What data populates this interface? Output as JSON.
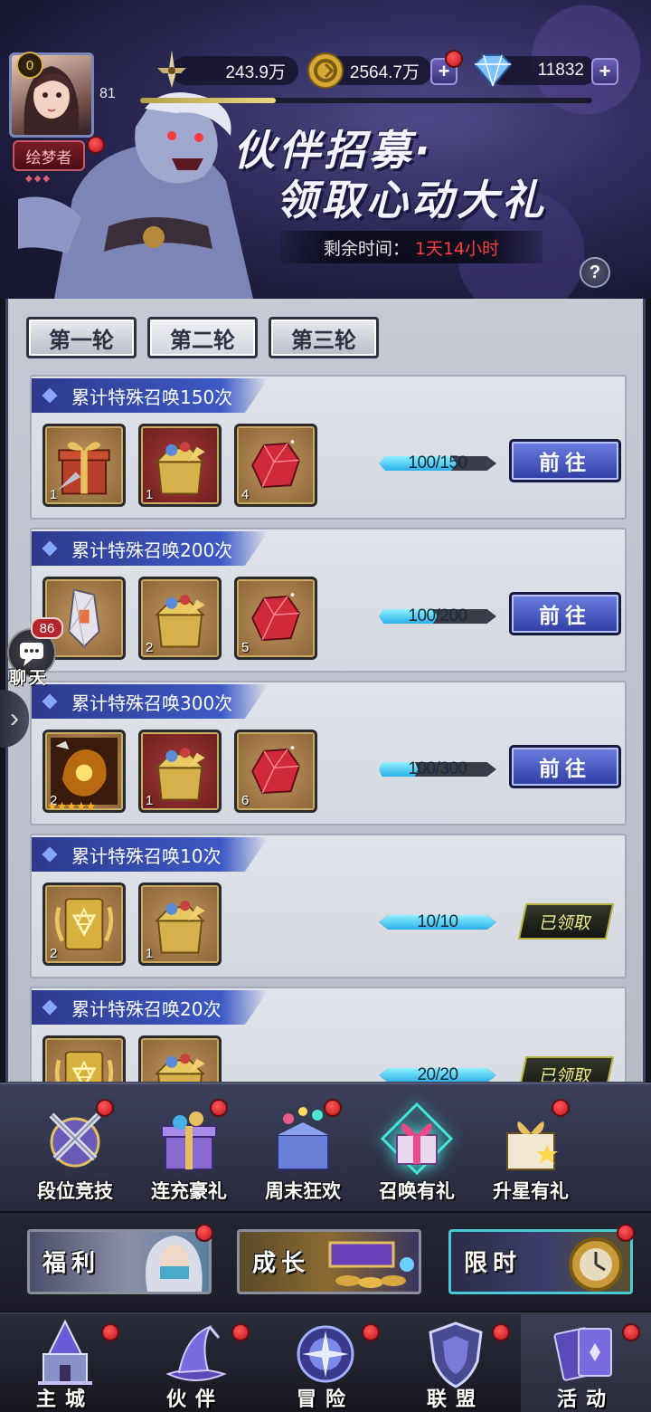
{
  "player": {
    "vip_level": "0",
    "level": "81",
    "title": "绘梦者",
    "exp_progress": 0.3
  },
  "resources": {
    "power": "243.9万",
    "gold": "2564.7万",
    "diamonds": "11832",
    "plus_symbol": "+"
  },
  "banner": {
    "title_line1": "伙伴招募·",
    "title_line2": "领取心动大礼",
    "countdown_label": "剩余时间：",
    "countdown_value": "1天14小时",
    "help_symbol": "?"
  },
  "round_tabs": [
    "第一轮",
    "第二轮",
    "第三轮"
  ],
  "tasks": [
    {
      "title": "累计特殊召唤150次",
      "progress_text": "100/150",
      "progress": 0.667,
      "action": "前往",
      "rewards": [
        {
          "icon": "gift-box-icon",
          "count": "1",
          "frame": "brown"
        },
        {
          "icon": "golden-chest-icon",
          "count": "1",
          "frame": "red"
        },
        {
          "icon": "red-crystal-icon",
          "count": "4",
          "frame": "brown"
        }
      ]
    },
    {
      "title": "累计特殊召唤200次",
      "progress_text": "100/200",
      "progress": 0.5,
      "action": "前往",
      "rewards": [
        {
          "icon": "crystal-shard-icon",
          "count": "",
          "frame": "brown"
        },
        {
          "icon": "golden-chest-icon",
          "count": "2",
          "frame": "brown"
        },
        {
          "icon": "red-crystal-icon",
          "count": "5",
          "frame": "brown"
        }
      ]
    },
    {
      "title": "累计特殊召唤300次",
      "progress_text": "100/300",
      "progress": 0.333,
      "action": "前往",
      "rewards": [
        {
          "icon": "hero-fragment-icon",
          "count": "2",
          "frame": "brown",
          "stars": "★★★★★"
        },
        {
          "icon": "golden-chest-icon",
          "count": "1",
          "frame": "red"
        },
        {
          "icon": "red-crystal-icon",
          "count": "6",
          "frame": "brown"
        }
      ]
    },
    {
      "title": "累计特殊召唤10次",
      "progress_text": "10/10",
      "progress": 1,
      "action": "已领取",
      "rewards": [
        {
          "icon": "golden-scroll-icon",
          "count": "2",
          "frame": "brown"
        },
        {
          "icon": "golden-chest-icon",
          "count": "1",
          "frame": "brown"
        }
      ]
    },
    {
      "title": "累计特殊召唤20次",
      "progress_text": "20/20",
      "progress": 1,
      "action": "已领取",
      "rewards": [
        {
          "icon": "golden-scroll-icon",
          "count": "",
          "frame": "brown"
        },
        {
          "icon": "golden-chest-icon",
          "count": "",
          "frame": "brown"
        }
      ]
    }
  ],
  "chat": {
    "count": "86",
    "label": "聊天",
    "arrow": "›"
  },
  "activities": [
    {
      "label": "段位竞技",
      "icon": "crossed-swords-icon",
      "badge": true
    },
    {
      "label": "连充豪礼",
      "icon": "treasure-gift-icon",
      "badge": true
    },
    {
      "label": "周末狂欢",
      "icon": "party-gift-icon",
      "badge": true
    },
    {
      "label": "召唤有礼",
      "icon": "pink-gift-icon",
      "badge": false,
      "active": true
    },
    {
      "label": "升星有礼",
      "icon": "star-gift-icon",
      "badge": true
    }
  ],
  "categories": [
    {
      "label": "福利",
      "badge": true
    },
    {
      "label": "成长",
      "badge": false
    },
    {
      "label": "限时",
      "badge": true
    }
  ],
  "nav": [
    {
      "label": "主城",
      "icon": "castle-icon",
      "badge": true
    },
    {
      "label": "伙伴",
      "icon": "wizard-hat-icon",
      "badge": true
    },
    {
      "label": "冒险",
      "icon": "compass-portal-icon",
      "badge": true
    },
    {
      "label": "联盟",
      "icon": "shield-icon",
      "badge": true
    },
    {
      "label": "活动",
      "icon": "cards-icon",
      "badge": true,
      "active": true
    }
  ],
  "colors": {
    "accent_blue": "#3d59c6",
    "badge_red": "#c4101a",
    "countdown_red": "#ff3b3b",
    "progress_cyan": "#2ab0e8"
  }
}
